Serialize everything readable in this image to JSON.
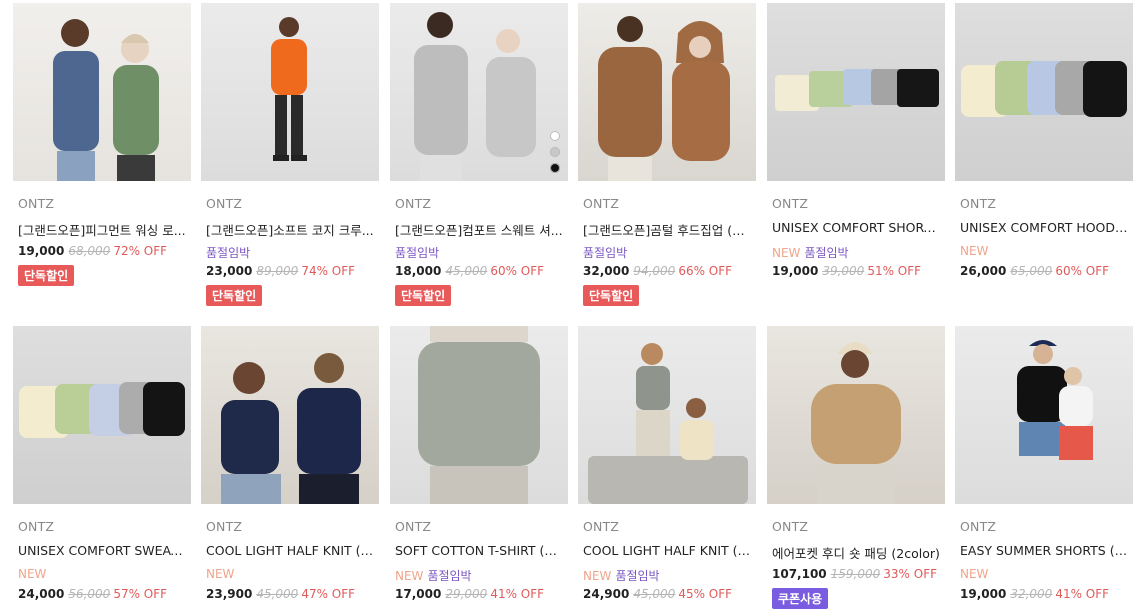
{
  "products": [
    {
      "brand": "ONTZ",
      "name": "[그랜드오픈]피그먼트 워싱 로...",
      "new": "",
      "sold": "",
      "price": "19,000",
      "orig": "68,000",
      "off": "72% OFF",
      "badge": "단독할인",
      "badge_color": "#e85a5a",
      "no_tags": true
    },
    {
      "brand": "ONTZ",
      "name": "[그랜드오픈]소프트 코지 크루...",
      "new": "",
      "sold": "품절임박",
      "price": "23,000",
      "orig": "89,000",
      "off": "74% OFF",
      "badge": "단독할인",
      "badge_color": "#e85a5a"
    },
    {
      "brand": "ONTZ",
      "name": "[그랜드오픈]컴포트 스웨트 셔...",
      "new": "",
      "sold": "품절임박",
      "price": "18,000",
      "orig": "45,000",
      "off": "60% OFF",
      "badge": "단독할인",
      "badge_color": "#e85a5a"
    },
    {
      "brand": "ONTZ",
      "name": "[그랜드오픈]곰털 후드집업 (3c...",
      "new": "",
      "sold": "품절임박",
      "price": "32,000",
      "orig": "94,000",
      "off": "66% OFF",
      "badge": "단독할인",
      "badge_color": "#e85a5a"
    },
    {
      "brand": "ONTZ",
      "name": "UNISEX COMFORT SHORTS ...",
      "new": "NEW",
      "sold": "품절임박",
      "price": "19,000",
      "orig": "39,000",
      "off": "51% OFF",
      "badge": ""
    },
    {
      "brand": "ONTZ",
      "name": "UNISEX COMFORT HOODIE ...",
      "new": "NEW",
      "sold": "",
      "price": "26,000",
      "orig": "65,000",
      "off": "60% OFF",
      "badge": ""
    },
    {
      "brand": "ONTZ",
      "name": "UNISEX COMFORT SWEATS...",
      "new": "NEW",
      "sold": "",
      "price": "24,000",
      "orig": "56,000",
      "off": "57% OFF",
      "badge": ""
    },
    {
      "brand": "ONTZ",
      "name": "COOL LIGHT HALF KNIT (7c...",
      "new": "NEW",
      "sold": "",
      "price": "23,900",
      "orig": "45,000",
      "off": "47% OFF",
      "badge": ""
    },
    {
      "brand": "ONTZ",
      "name": "SOFT COTTON T-SHIRT (5col...",
      "new": "NEW",
      "sold": "품절임박",
      "price": "17,000",
      "orig": "29,000",
      "off": "41% OFF",
      "badge": ""
    },
    {
      "brand": "ONTZ",
      "name": "COOL LIGHT HALF KNIT (7c...",
      "new": "NEW",
      "sold": "품절임박",
      "price": "24,900",
      "orig": "45,000",
      "off": "45% OFF",
      "badge": ""
    },
    {
      "brand": "ONTZ",
      "name": "에어포켓 후디 숏 패딩 (2color)",
      "new": "",
      "sold": "",
      "price": "107,100",
      "orig": "159,000",
      "off": "33% OFF",
      "badge": "쿠폰사용",
      "badge_color": "#7a5ce0",
      "no_tags": true
    },
    {
      "brand": "ONTZ",
      "name": "EASY SUMMER SHORTS (4c...",
      "new": "NEW",
      "sold": "",
      "price": "19,000",
      "orig": "32,000",
      "off": "41% OFF",
      "badge": ""
    }
  ],
  "colors": {
    "new": "#f0a48c",
    "sold": "#7b56c4",
    "off": "#e05a5a",
    "badge_red": "#e85a5a",
    "badge_purple": "#7a5ce0"
  },
  "image_icons": [
    "product-photo-crew-sweatshirt",
    "product-photo-orange-sweater",
    "product-photo-grey-sweatshirt",
    "product-photo-fur-hoodie",
    "product-photo-shorts-colors",
    "product-photo-hoodie-colors",
    "product-photo-sweatshirt-colors",
    "product-photo-navy-knit",
    "product-photo-grey-tshirt",
    "product-photo-half-knit",
    "product-photo-puffer",
    "product-photo-summer-shorts"
  ],
  "swatch_colors": [
    "#ffffff",
    "#c8c8c8",
    "#111111"
  ]
}
